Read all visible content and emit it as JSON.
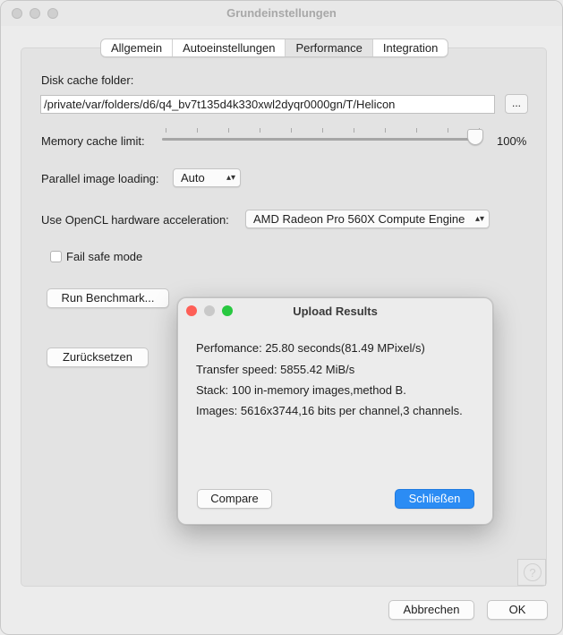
{
  "window": {
    "title": "Grundeinstellungen"
  },
  "tabs": [
    {
      "label": "Allgemein",
      "active": false
    },
    {
      "label": "Autoeinstellungen",
      "active": false
    },
    {
      "label": "Performance",
      "active": true
    },
    {
      "label": "Integration",
      "active": false
    }
  ],
  "performance": {
    "disk_cache_label": "Disk cache folder:",
    "disk_cache_path": "/private/var/folders/d6/q4_bv7t135d4k330xwl2dyqr0000gn/T/Helicon",
    "browse_label": "...",
    "memory_cache_label": "Memory cache limit:",
    "memory_cache_value": "100%",
    "memory_cache_fraction": 1.0,
    "parallel_label": "Parallel image loading:",
    "parallel_value": "Auto",
    "opencl_label": "Use OpenCL hardware acceleration:",
    "opencl_value": "AMD Radeon Pro 560X Compute Engine",
    "failsafe_label": "Fail safe mode",
    "failsafe_checked": false,
    "benchmark_label": "Run Benchmark...",
    "reset_label": "Zurücksetzen"
  },
  "footer": {
    "cancel_label": "Abbrechen",
    "ok_label": "OK",
    "help_symbol": "?"
  },
  "dialog": {
    "title": "Upload Results",
    "performance_line": "Perfomance: 25.80 seconds(81.49 MPixel/s)",
    "transfer_line": "Transfer speed: 5855.42 MiB/s",
    "stack_line": "Stack: 100 in-memory images,method B.",
    "images_line": "Images: 5616x3744,16 bits per channel,3 channels.",
    "compare_label": "Compare",
    "close_label": "Schließen"
  },
  "colors": {
    "close_light": "#fe5f57",
    "minimize_light": "#c9c9c9",
    "zoom_light": "#28c840",
    "primary_button": "#2b8cf4"
  },
  "icons": {
    "popup_arrows": "⌃⌄",
    "help": "question-mark-icon"
  }
}
